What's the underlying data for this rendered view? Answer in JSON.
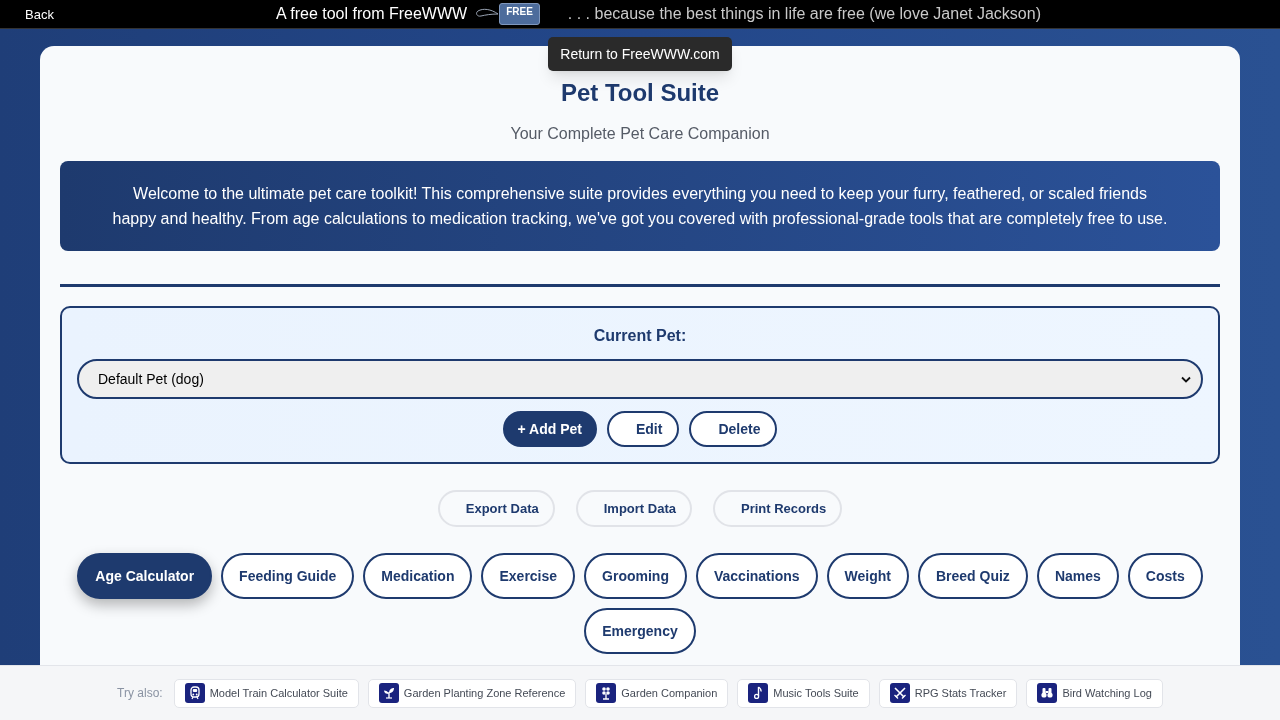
{
  "top_bar": {
    "back": "Back",
    "tagline": "A free tool from FreeWWW",
    "logo_text": "FREE",
    "motto": ". . . because the best things in life are free (we love Janet Jackson)"
  },
  "tooltip": "Return to FreeWWW.com",
  "header": {
    "title": "Pet Tool Suite",
    "subtitle": "Your Complete Pet Care Companion"
  },
  "intro": "Welcome to the ultimate pet care toolkit! This comprehensive suite provides everything you need to keep your furry, feathered, or scaled friends happy and healthy. From age calculations to medication tracking, we've got you covered with professional-grade tools that are completely free to use.",
  "pet_panel": {
    "label": "Current Pet:",
    "select_value": "Default Pet (dog)",
    "buttons": [
      {
        "label": "+ Add Pet",
        "kind": "primary"
      },
      {
        "label": "Edit",
        "kind": "outline"
      },
      {
        "label": "Delete",
        "kind": "outline"
      }
    ]
  },
  "data_buttons": [
    "Export Data",
    "Import Data",
    "Print Records"
  ],
  "tabs": [
    {
      "label": "Age Calculator",
      "selected": true
    },
    {
      "label": "Feeding Guide",
      "selected": false
    },
    {
      "label": "Medication",
      "selected": false
    },
    {
      "label": "Exercise",
      "selected": false
    },
    {
      "label": "Grooming",
      "selected": false
    },
    {
      "label": "Vaccinations",
      "selected": false
    },
    {
      "label": "Weight",
      "selected": false
    },
    {
      "label": "Breed Quiz",
      "selected": false
    },
    {
      "label": "Names",
      "selected": false
    },
    {
      "label": "Costs",
      "selected": false
    },
    {
      "label": "Emergency",
      "selected": false
    }
  ],
  "footer": {
    "label": "Try also:",
    "links": [
      "Model Train Calculator Suite",
      "Garden Planting Zone Reference",
      "Garden Companion",
      "Music Tools Suite",
      "RPG Stats Tracker",
      "Bird Watching Log"
    ]
  }
}
